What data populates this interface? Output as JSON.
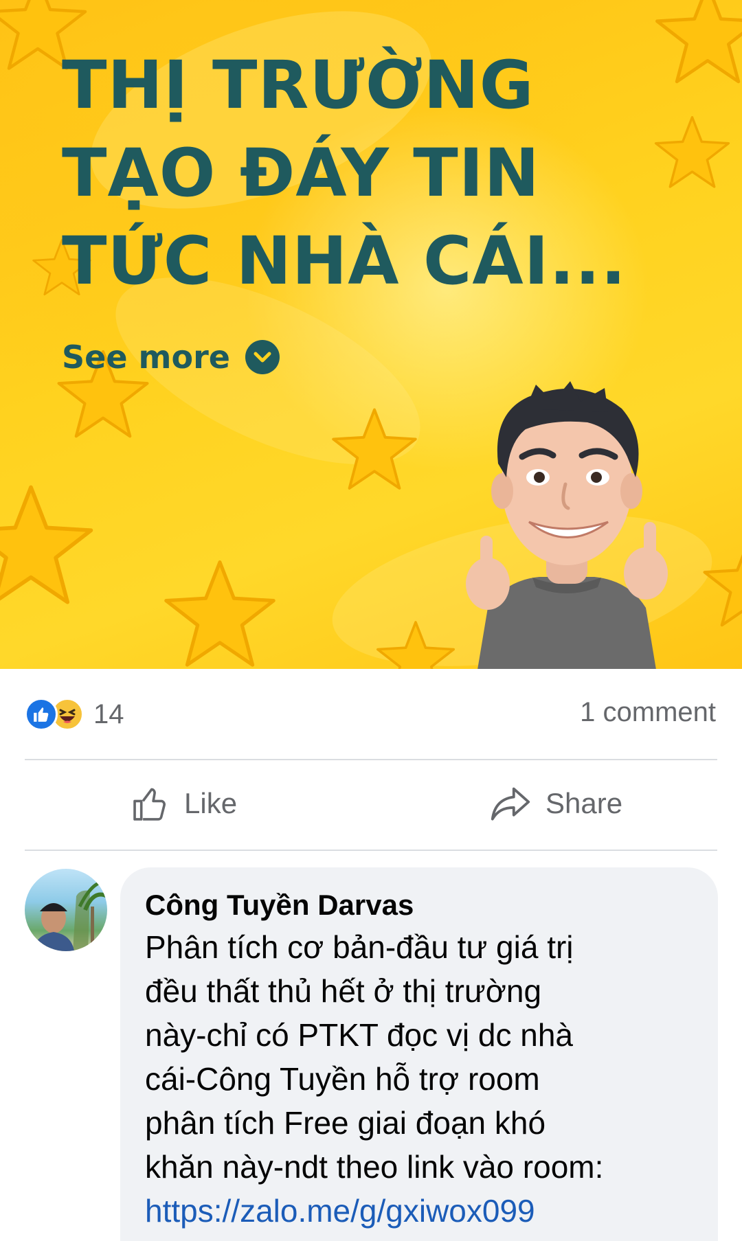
{
  "post": {
    "headline": "THỊ TRƯỜNG TẠO ĐÁY TIN TỨC NHÀ CÁI...",
    "see_more": "See more",
    "background": "yellow-stars",
    "accent_color": "#1f5a5e"
  },
  "reactions": {
    "icons": [
      "like-icon",
      "haha-icon"
    ],
    "count": "14",
    "comments": "1 comment"
  },
  "actions": {
    "like_label": "Like",
    "share_label": "Share"
  },
  "comment": {
    "author": "Công Tuyền Darvas",
    "text": "Phân tích cơ bản-đầu tư giá trị\nđều thất thủ hết ở thị trường\nnày-chỉ có PTKT đọc vị dc nhà\ncái-Công Tuyền hỗ trợ room\nphân tích Free giai đoạn khó\nkhăn này-ndt theo link vào room:",
    "link": "https://zalo.me/g/gxiwox099",
    "link_color": "#1b5cb8"
  }
}
